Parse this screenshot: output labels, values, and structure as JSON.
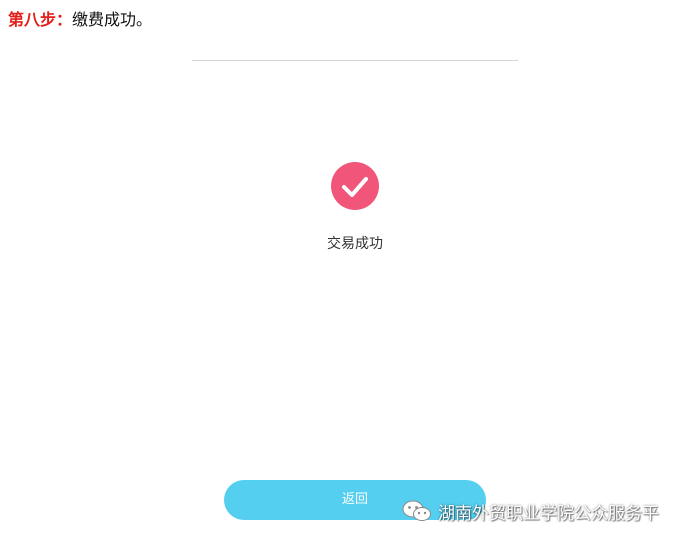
{
  "step": {
    "label": "第八步：",
    "text": "缴费成功。"
  },
  "result": {
    "icon": "check-circle-icon",
    "icon_color": "#f2557a",
    "status": "交易成功"
  },
  "actions": {
    "return_label": "返回",
    "return_color": "#55cff0"
  },
  "watermark": {
    "icon": "wechat-icon",
    "text": "湖南外贸职业学院公众服务平"
  }
}
